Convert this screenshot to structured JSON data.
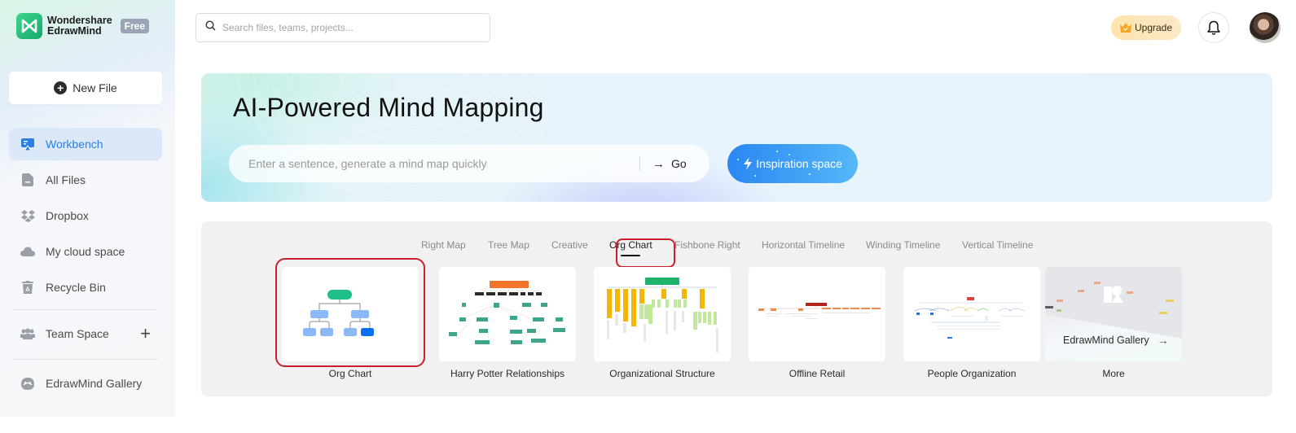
{
  "app": {
    "brand_line1": "Wondershare",
    "brand_line2": "EdrawMind",
    "plan_badge": "Free",
    "brand_color": "#22b877"
  },
  "sidebar": {
    "new_file_label": "New File",
    "items": [
      {
        "label": "Workbench",
        "icon": "workbench-icon",
        "active": true
      },
      {
        "label": "All Files",
        "icon": "file-icon",
        "active": false
      },
      {
        "label": "Dropbox",
        "icon": "dropbox-icon",
        "active": false
      },
      {
        "label": "My cloud space",
        "icon": "cloud-icon",
        "active": false
      },
      {
        "label": "Recycle Bin",
        "icon": "trash-icon",
        "active": false
      },
      {
        "label": "Team Space",
        "icon": "team-icon",
        "active": false,
        "action": "+"
      },
      {
        "label": "EdrawMind Gallery",
        "icon": "gallery-icon",
        "active": false
      }
    ],
    "active_color": "#2b7fe0"
  },
  "topbar": {
    "search_placeholder": "Search files, teams, projects...",
    "search_value": "",
    "upgrade_label": "Upgrade",
    "notifications_icon": "bell-icon",
    "avatar": "user-avatar"
  },
  "banner": {
    "title": "AI-Powered Mind Mapping",
    "input_placeholder": "Enter a sentence, generate a mind map quickly",
    "input_value": "",
    "go_label": "Go",
    "go_arrow": "→",
    "inspiration_label": "Inspiration space"
  },
  "templates": {
    "tabs": [
      {
        "label": "Right Map",
        "active": false
      },
      {
        "label": "Tree Map",
        "active": false
      },
      {
        "label": "Creative",
        "active": false
      },
      {
        "label": "Org Chart",
        "active": true
      },
      {
        "label": "Fishbone Right",
        "active": false
      },
      {
        "label": "Horizontal Timeline",
        "active": false
      },
      {
        "label": "Winding Timeline",
        "active": false
      },
      {
        "label": "Vertical Timeline",
        "active": false
      }
    ],
    "cards": [
      {
        "label": "Org Chart",
        "highlighted": true
      },
      {
        "label": "Harry Potter Relationships",
        "highlighted": false
      },
      {
        "label": "Organizational Structure",
        "highlighted": false
      },
      {
        "label": "Offline Retail",
        "highlighted": false
      },
      {
        "label": "People Organization",
        "highlighted": false
      },
      {
        "label": "More",
        "highlighted": false,
        "card_text": "EdrawMind Gallery",
        "card_arrow": "→"
      }
    ],
    "highlight_color": "#cc1f2b"
  }
}
